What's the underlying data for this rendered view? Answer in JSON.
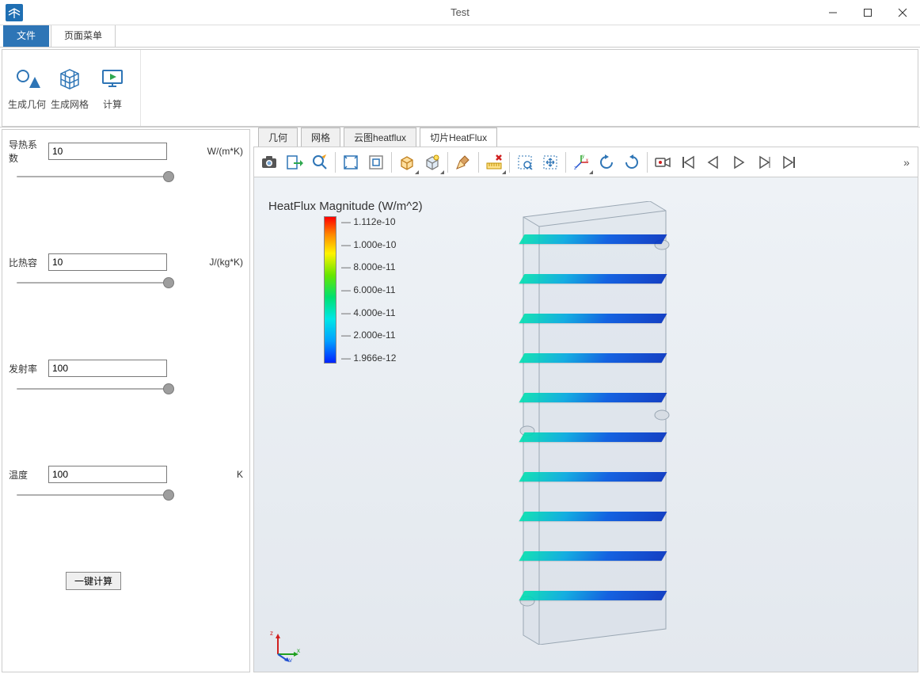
{
  "window": {
    "title": "Test"
  },
  "menutabs": {
    "file": "文件",
    "page_menu": "页面菜单"
  },
  "ribbon": {
    "geom": "生成几何",
    "mesh": "生成网格",
    "compute": "计算"
  },
  "sidebar": {
    "thermal_cond": {
      "label": "导热系数",
      "value": "10",
      "unit": "W/(m*K)"
    },
    "specific_heat": {
      "label": "比热容",
      "value": "10",
      "unit": "J/(kg*K)"
    },
    "emissivity": {
      "label": "发射率",
      "value": "100",
      "unit": ""
    },
    "temperature": {
      "label": "温度",
      "value": "100",
      "unit": "K"
    },
    "calc_button": "一键计算"
  },
  "canvas_tabs": {
    "geom": "几何",
    "mesh": "网格",
    "cloud": "云图heatflux",
    "slice": "切片HeatFlux"
  },
  "legend": {
    "title": "HeatFlux Magnitude (W/m^2)",
    "ticks": [
      "1.112e-10",
      "1.000e-10",
      "8.000e-11",
      "6.000e-11",
      "4.000e-11",
      "2.000e-11",
      "1.966e-12"
    ]
  },
  "overflow": "»"
}
